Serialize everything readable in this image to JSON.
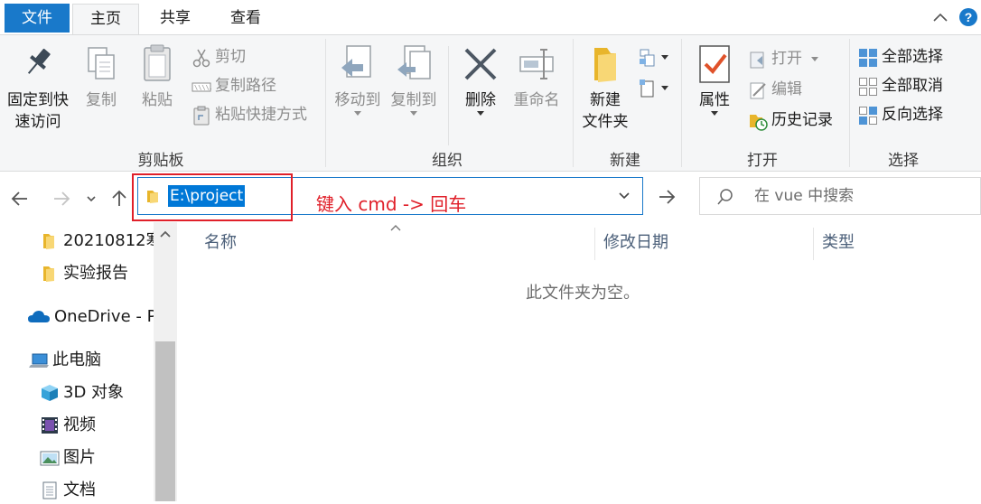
{
  "tabs": {
    "file": "文件",
    "home": "主页",
    "share": "共享",
    "view": "查看"
  },
  "ribbon": {
    "clipboard": {
      "group_label": "剪贴板",
      "pin_label_1": "固定到快",
      "pin_label_2": "速访问",
      "copy": "复制",
      "paste": "粘贴",
      "cut": "剪切",
      "copy_path": "复制路径",
      "paste_shortcut": "粘贴快捷方式"
    },
    "organize": {
      "group_label": "组织",
      "move_to": "移动到",
      "copy_to": "复制到",
      "delete": "删除",
      "rename": "重命名"
    },
    "new": {
      "group_label": "新建",
      "new_folder_1": "新建",
      "new_folder_2": "文件夹"
    },
    "open": {
      "group_label": "打开",
      "properties": "属性",
      "open": "打开",
      "edit": "编辑",
      "history": "历史记录"
    },
    "select": {
      "group_label": "选择",
      "select_all": "全部选择",
      "select_none": "全部取消",
      "invert": "反向选择"
    }
  },
  "address": {
    "path": "E:\\project",
    "annotation": "键入 cmd -> 回车",
    "search_placeholder": "在 vue 中搜索"
  },
  "nav_pane": {
    "items": [
      {
        "label": "20210812寒",
        "icon": "folder-icon"
      },
      {
        "label": "实验报告",
        "icon": "folder-icon"
      },
      {
        "label": "OneDrive - P",
        "icon": "cloud-icon"
      },
      {
        "label": "此电脑",
        "icon": "computer-icon"
      },
      {
        "label": "3D 对象",
        "icon": "cube-icon"
      },
      {
        "label": "视频",
        "icon": "video-icon"
      },
      {
        "label": "图片",
        "icon": "picture-icon"
      },
      {
        "label": "文档",
        "icon": "document-icon"
      }
    ]
  },
  "content": {
    "columns": [
      "名称",
      "修改日期",
      "类型"
    ],
    "empty_message": "此文件夹为空。"
  },
  "colors": {
    "accent": "#1979ca",
    "annotation": "#e0202a",
    "selection": "#0078d7"
  }
}
